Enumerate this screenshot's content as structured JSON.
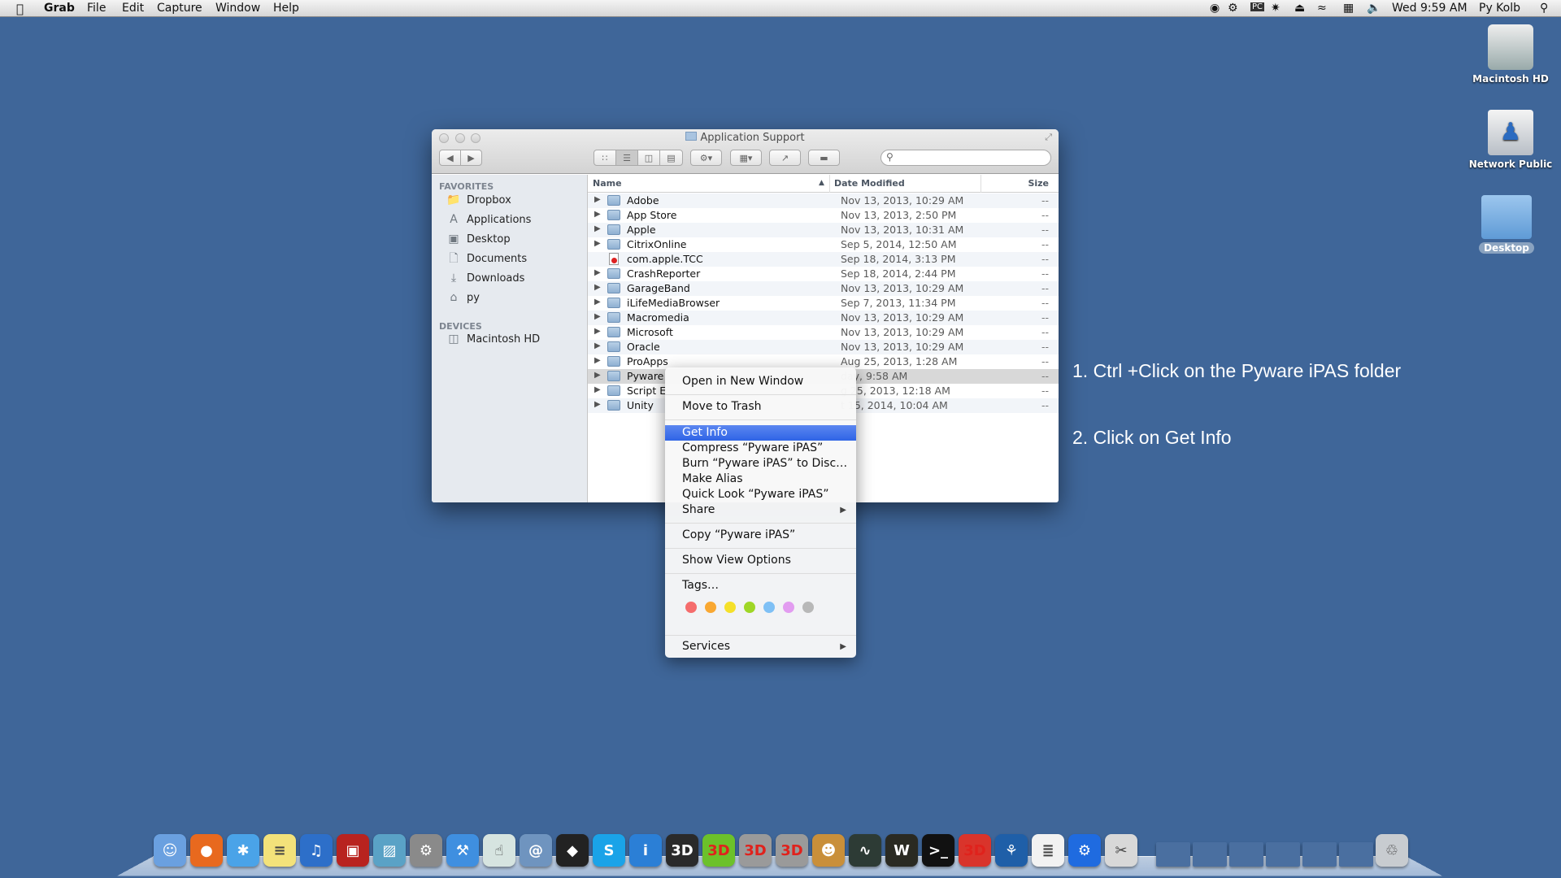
{
  "menubar": {
    "app": "Grab",
    "items": [
      "File",
      "Edit",
      "Capture",
      "Window",
      "Help"
    ],
    "clock": "Wed 9:59 AM",
    "user": "Py Kolb",
    "status_icons": [
      "skype-icon",
      "gear-badge-icon",
      "mypc-icon",
      "fan-icon",
      "eject-icon",
      "wifi-icon",
      "keyboard-viewer-icon",
      "volume-icon"
    ]
  },
  "desktop_icons": [
    {
      "label": "Macintosh HD",
      "icon": "hard-drive-icon"
    },
    {
      "label": "Network Public",
      "icon": "network-share-icon"
    },
    {
      "label": "Desktop",
      "icon": "folder-icon"
    }
  ],
  "finder": {
    "title": "Application Support",
    "sidebar": {
      "favorites_header": "FAVORITES",
      "favorites": [
        {
          "label": "Dropbox",
          "icon": "folder-icon"
        },
        {
          "label": "Applications",
          "icon": "applications-icon"
        },
        {
          "label": "Desktop",
          "icon": "desktop-icon"
        },
        {
          "label": "Documents",
          "icon": "documents-icon"
        },
        {
          "label": "Downloads",
          "icon": "downloads-icon"
        },
        {
          "label": "py",
          "icon": "home-icon"
        }
      ],
      "devices_header": "DEVICES",
      "devices": [
        {
          "label": "Macintosh HD",
          "icon": "hard-drive-icon"
        }
      ]
    },
    "columns": {
      "name": "Name",
      "date": "Date Modified",
      "size": "Size"
    },
    "rows": [
      {
        "name": "Adobe",
        "date": "Nov 13, 2013, 10:29 AM",
        "size": "--",
        "type": "folder"
      },
      {
        "name": "App Store",
        "date": "Nov 13, 2013, 2:50 PM",
        "size": "--",
        "type": "folder"
      },
      {
        "name": "Apple",
        "date": "Nov 13, 2013, 10:31 AM",
        "size": "--",
        "type": "folder"
      },
      {
        "name": "CitrixOnline",
        "date": "Sep 5, 2014, 12:50 AM",
        "size": "--",
        "type": "folder"
      },
      {
        "name": "com.apple.TCC",
        "date": "Sep 18, 2014, 3:13 PM",
        "size": "--",
        "type": "locked"
      },
      {
        "name": "CrashReporter",
        "date": "Sep 18, 2014, 2:44 PM",
        "size": "--",
        "type": "folder"
      },
      {
        "name": "GarageBand",
        "date": "Nov 13, 2013, 10:29 AM",
        "size": "--",
        "type": "folder"
      },
      {
        "name": "iLifeMediaBrowser",
        "date": "Sep 7, 2013, 11:34 PM",
        "size": "--",
        "type": "folder"
      },
      {
        "name": "Macromedia",
        "date": "Nov 13, 2013, 10:29 AM",
        "size": "--",
        "type": "folder"
      },
      {
        "name": "Microsoft",
        "date": "Nov 13, 2013, 10:29 AM",
        "size": "--",
        "type": "folder"
      },
      {
        "name": "Oracle",
        "date": "Nov 13, 2013, 10:29 AM",
        "size": "--",
        "type": "folder"
      },
      {
        "name": "ProApps",
        "date": "Aug 25, 2013, 1:28 AM",
        "size": "--",
        "type": "folder"
      },
      {
        "name": "Pyware",
        "date": "day, 9:58 AM",
        "size": "--",
        "type": "folder",
        "selected": true
      },
      {
        "name": "Script E",
        "date": "g 25, 2013, 12:18 AM",
        "size": "--",
        "type": "folder"
      },
      {
        "name": "Unity",
        "date": "t 15, 2014, 10:04 AM",
        "size": "--",
        "type": "folder"
      }
    ]
  },
  "context_menu": {
    "items": [
      "Open in New Window",
      "Move to Trash",
      "Get Info",
      "Compress “Pyware iPAS”",
      "Burn “Pyware iPAS” to Disc…",
      "Make Alias",
      "Quick Look “Pyware iPAS”",
      "Share",
      "Copy “Pyware iPAS”",
      "Show View Options",
      "Tags…",
      "Services"
    ],
    "highlighted": "Get Info",
    "tag_colors": [
      "#f56c6c",
      "#f9a832",
      "#f5e02a",
      "#9fd626",
      "#7fc0f5",
      "#e29cf0",
      "#b8b8b8"
    ]
  },
  "annotations": [
    "1. Ctrl +Click on the Pyware iPAS folder",
    "2. Click on Get Info"
  ],
  "dock": [
    {
      "name": "finder",
      "color": "#6aa0e0",
      "glyph": "☺"
    },
    {
      "name": "firefox",
      "color": "#e8691e",
      "glyph": "●"
    },
    {
      "name": "safari",
      "color": "#4aa3e8",
      "glyph": "✱"
    },
    {
      "name": "stickies",
      "color": "#f3e27a",
      "glyph": "≡"
    },
    {
      "name": "itunes",
      "color": "#2d6fc9",
      "glyph": "♫"
    },
    {
      "name": "photo-booth",
      "color": "#b8231f",
      "glyph": "▣"
    },
    {
      "name": "iphoto",
      "color": "#5aa2c6",
      "glyph": "▨"
    },
    {
      "name": "system-preferences",
      "color": "#8a8a8a",
      "glyph": "⚙"
    },
    {
      "name": "xcode",
      "color": "#3f8fe0",
      "glyph": "⚒"
    },
    {
      "name": "touch-app",
      "color": "#d6e4e0",
      "glyph": "☝"
    },
    {
      "name": "remote-app",
      "color": "#6f94bf",
      "glyph": "@"
    },
    {
      "name": "unity",
      "color": "#222222",
      "glyph": "◆"
    },
    {
      "name": "skype",
      "color": "#1aa3e8",
      "glyph": "S"
    },
    {
      "name": "info",
      "color": "#2b7fd6",
      "glyph": "i"
    },
    {
      "name": "3d-app",
      "color": "#2a2a2a",
      "glyph": "3D"
    },
    {
      "name": "3ds-max-5",
      "color": "#6cc12a",
      "glyph": "3D"
    },
    {
      "name": "3ds-max-6",
      "color": "#9a9a9a",
      "glyph": "3D"
    },
    {
      "name": "3ds-max-7",
      "color": "#9a9a9a",
      "glyph": "3D"
    },
    {
      "name": "cyberduck-monkey",
      "color": "#c98f3a",
      "glyph": "☻"
    },
    {
      "name": "activity-monitor",
      "color": "#2d3b35",
      "glyph": "∿"
    },
    {
      "name": "console",
      "color": "#2a2a22",
      "glyph": "W"
    },
    {
      "name": "terminal",
      "color": "#111111",
      "glyph": ">_"
    },
    {
      "name": "3ds-max-8",
      "color": "#d9342b",
      "glyph": "3D"
    },
    {
      "name": "sourcetree",
      "color": "#1f5fa8",
      "glyph": "⚘"
    },
    {
      "name": "textedit",
      "color": "#f2f2f2",
      "glyph": "≣"
    },
    {
      "name": "settings-gear",
      "color": "#1f6be0",
      "glyph": "⚙"
    },
    {
      "name": "grab",
      "color": "#d8d8d8",
      "glyph": "✂"
    },
    {
      "name": "minimized-window-1",
      "color": "#4a6fa0",
      "glyph": ""
    },
    {
      "name": "minimized-window-2",
      "color": "#4a6fa0",
      "glyph": ""
    },
    {
      "name": "minimized-window-3",
      "color": "#4a6fa0",
      "glyph": ""
    },
    {
      "name": "minimized-window-4",
      "color": "#4a6fa0",
      "glyph": ""
    },
    {
      "name": "minimized-window-5",
      "color": "#4a6fa0",
      "glyph": ""
    },
    {
      "name": "minimized-window-6",
      "color": "#4a6fa0",
      "glyph": ""
    },
    {
      "name": "trash",
      "color": "#c8ccd0",
      "glyph": "♲"
    }
  ]
}
